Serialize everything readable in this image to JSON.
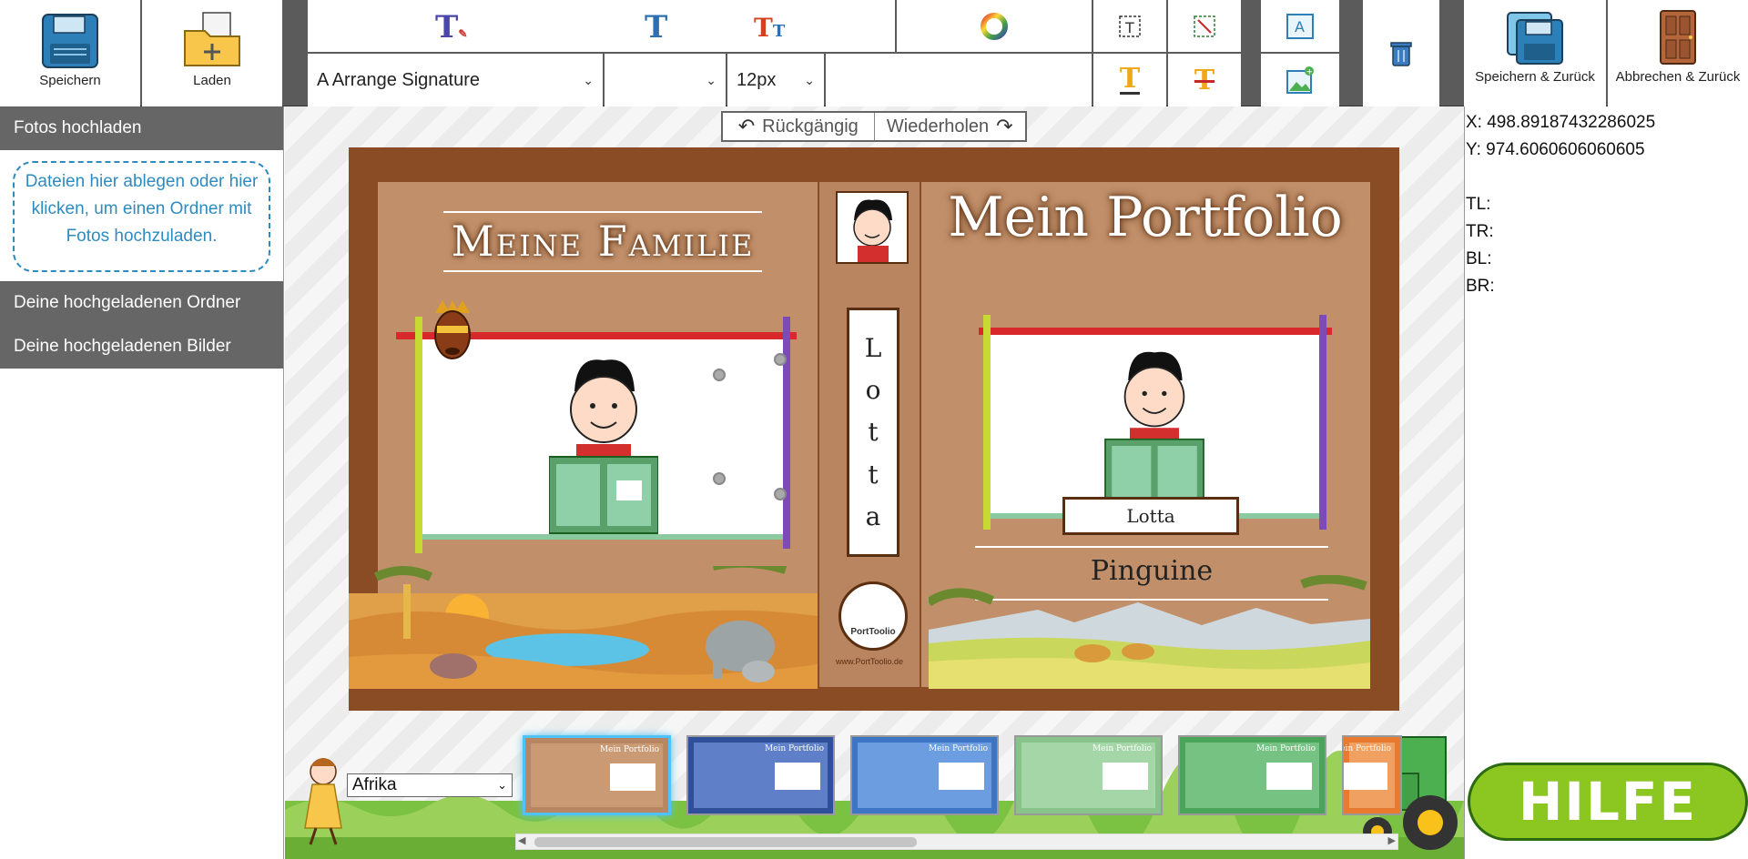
{
  "toolbar": {
    "save_label": "Speichern",
    "load_label": "Laden",
    "font_family_value": "A Arrange Signature",
    "font_weight_value": "",
    "font_size_value": "12px",
    "save_back_label": "Speichern & Zurück",
    "cancel_back_label": "Abbrechen & Zurück"
  },
  "left_panel": {
    "upload_heading": "Fotos hochladen",
    "drop_zone_text": "Dateien hier ablegen oder hier klicken, um einen Ordner mit Fotos hochzuladen.",
    "uploaded_folders": "Deine hochgeladenen Ordner",
    "uploaded_images": "Deine hochgeladenen Bilder"
  },
  "history": {
    "undo_label": "Rückgängig",
    "redo_label": "Wiederholen"
  },
  "cover": {
    "back_title": "Meine Familie",
    "front_title": "Mein Portfolio",
    "spine_letters": [
      "L",
      "o",
      "t",
      "t",
      "a"
    ],
    "name_label": "Lotta",
    "group_label": "Pinguine",
    "logo_text": "PortToolio",
    "website": "www.PortToolio.de"
  },
  "info": {
    "x": "X: 498.89187432286025",
    "y": "Y: 974.6060606060605",
    "tl": "TL:",
    "tr": "TR:",
    "bl": "BL:",
    "br": "BR:"
  },
  "theme": {
    "selected": "Afrika"
  },
  "help_label": "HILFE",
  "thumbnails": [
    {
      "title": "Mein Portfolio",
      "bg": "#b98664",
      "frame": "#c99a74"
    },
    {
      "title": "Mein Portfolio",
      "bg": "#2f4f9a",
      "frame": "#5f7fc8"
    },
    {
      "title": "Mein Portfolio",
      "bg": "#3d74c4",
      "frame": "#6b9de0"
    },
    {
      "title": "Mein Portfolio",
      "bg": "#88c48a",
      "frame": "#a5d6a7"
    },
    {
      "title": "Mein Portfolio",
      "bg": "#4aa55a",
      "frame": "#76c283"
    },
    {
      "title": "Mein Portfolio",
      "bg": "#e87b2f",
      "frame": "#f0a060"
    }
  ],
  "colors": {
    "toolbar_gray": "#5b5b5b",
    "link_blue": "#2e8bc0",
    "cover_brown": "#8a4c24",
    "help_green": "#8cc620"
  }
}
